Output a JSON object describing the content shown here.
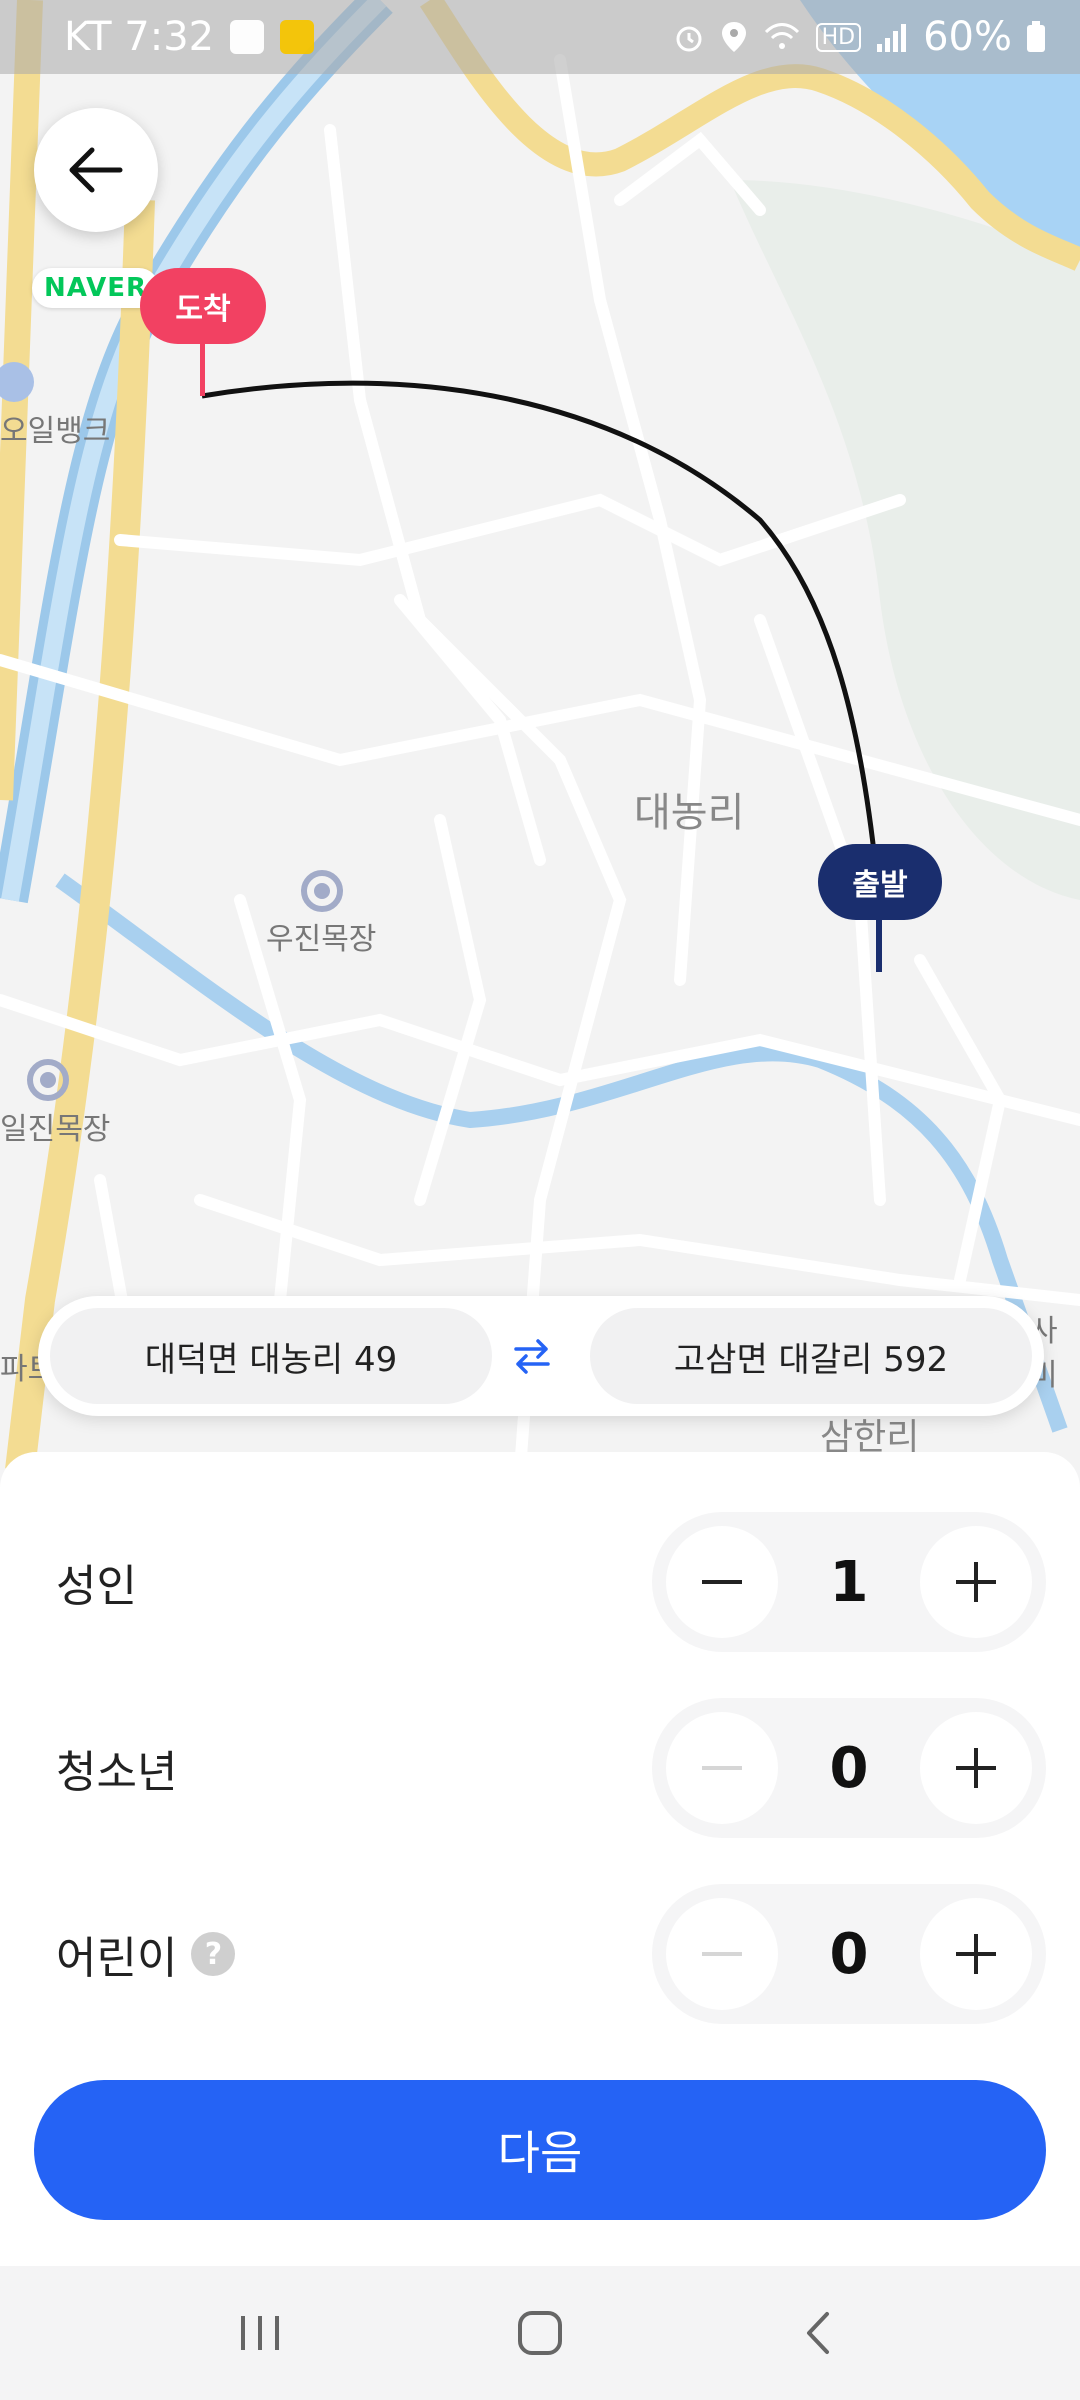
{
  "status_bar": {
    "carrier_time": "KT 7:32",
    "battery": "60%",
    "icons": [
      "image-icon",
      "kb-app-icon",
      "alarm-icon",
      "location-icon",
      "wifi-icon",
      "hd-icon",
      "signal-icon",
      "battery-icon"
    ]
  },
  "map": {
    "brand": "NAVER",
    "dest_pin": "도착",
    "start_pin": "출발",
    "labels": {
      "village": "대농리",
      "place1": "우진목장",
      "place2": "일진목장",
      "place3": "오일뱅크",
      "place4": "삼한리",
      "edge_left": "파트",
      "edge_right": "사미"
    }
  },
  "route": {
    "from": "대덕면 대농리 49",
    "to": "고삼면 대갈리 592"
  },
  "passengers": [
    {
      "label": "성인",
      "count": "1",
      "minus_enabled": true
    },
    {
      "label": "청소년",
      "count": "0",
      "minus_enabled": false
    },
    {
      "label": "어린이",
      "count": "0",
      "minus_enabled": false,
      "help": "?"
    }
  ],
  "next_label": "다음",
  "colors": {
    "primary": "#2563f5",
    "dest_pin": "#f24162",
    "start_pin": "#1a2e6e",
    "naver_green": "#03c75a"
  }
}
